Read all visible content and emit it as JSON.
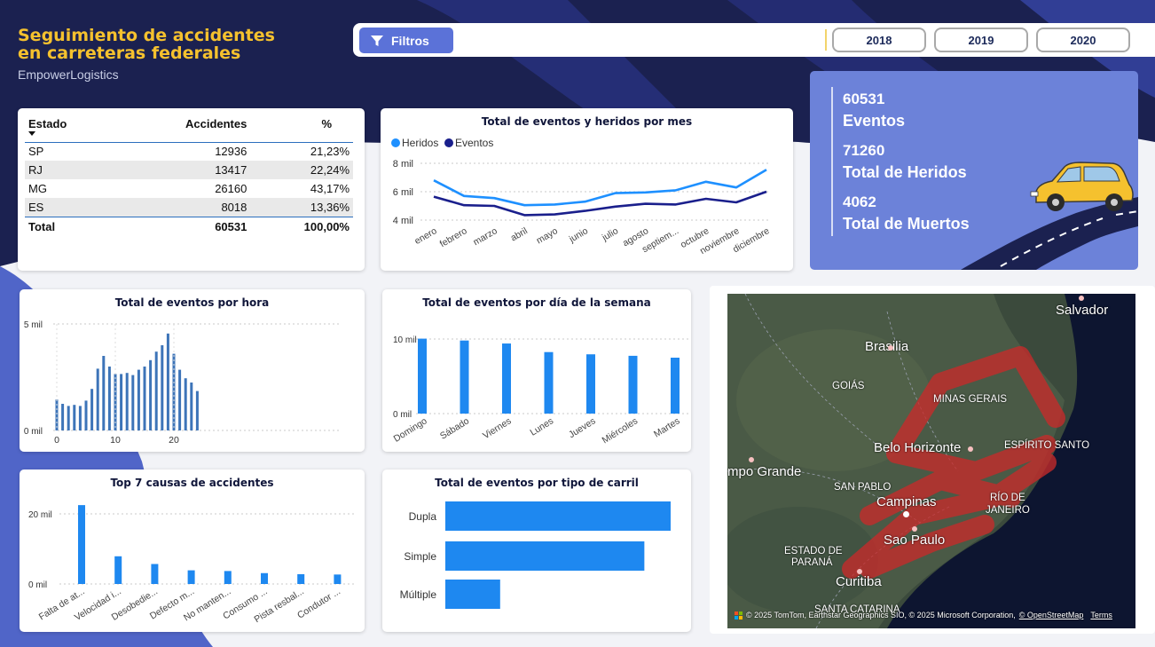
{
  "header": {
    "title_line1": "Seguimiento de accidentes",
    "title_line2": "en carreteras federales",
    "subtitle": "EmpowerLogistics"
  },
  "filters": {
    "button_label": "Filtros",
    "years": [
      "2018",
      "2019",
      "2020"
    ]
  },
  "state_table": {
    "columns": [
      "Estado",
      "Accidentes",
      "%"
    ],
    "rows": [
      {
        "estado": "SP",
        "accidentes": "12936",
        "pct": "21,23%"
      },
      {
        "estado": "RJ",
        "accidentes": "13417",
        "pct": "22,24%"
      },
      {
        "estado": "MG",
        "accidentes": "26160",
        "pct": "43,17%"
      },
      {
        "estado": "ES",
        "accidentes": "8018",
        "pct": "13,36%"
      }
    ],
    "total": {
      "estado": "Total",
      "accidentes": "60531",
      "pct": "100,00%"
    }
  },
  "kpis": [
    {
      "value": "60531",
      "label": "Eventos"
    },
    {
      "value": "71260",
      "label": "Total de Heridos"
    },
    {
      "value": "4062",
      "label": "Total de Muertos"
    }
  ],
  "colors": {
    "navy": "#1b2150",
    "accent": "#f5c12e",
    "blue_bar": "#1e88f0",
    "steel_bar": "#3d74b8",
    "kpi_bg": "#6c82d9",
    "heridos": "#1e90ff",
    "eventos": "#1a1f8c"
  },
  "map": {
    "icon": "map-icon",
    "attribution": "© 2025 TomTom, Earthstar Geographics SIO, © 2025 Microsoft Corporation,",
    "attribution_link": "© OpenStreetMap",
    "terms": "Terms",
    "labels": {
      "salvador": "Salvador",
      "brasilia": "Brasilia",
      "goias": "GOIÁS",
      "minas": "MINAS GERAIS",
      "bh": "Belo Horizonte",
      "es": "ESPÍRITO SANTO",
      "campo": "mpo Grande",
      "sanpablo": "SAN PABLO",
      "campinas": "Campinas",
      "rio1": "RÍO DE",
      "rio2": "JANEIRO",
      "sp": "Sao Paulo",
      "parana1": "ESTADO DE",
      "parana2": "PARANÁ",
      "curitiba": "Curitiba",
      "sc": "SANTA CATARINA"
    }
  },
  "chart_data": [
    {
      "type": "line",
      "title": "Total de eventos y heridos por mes",
      "categories": [
        "enero",
        "febrero",
        "marzo",
        "abril",
        "mayo",
        "junio",
        "julio",
        "agosto",
        "septiem...",
        "octubre",
        "noviembre",
        "diciembre"
      ],
      "series": [
        {
          "name": "Heridos",
          "values": [
            6800,
            5700,
            5550,
            5050,
            5100,
            5300,
            5900,
            5950,
            6100,
            6700,
            6300,
            7550
          ]
        },
        {
          "name": "Eventos",
          "values": [
            5650,
            5050,
            5000,
            4350,
            4400,
            4650,
            4950,
            5150,
            5100,
            5500,
            5250,
            6000
          ]
        }
      ],
      "yticks": [
        "4 mil",
        "6 mil",
        "8 mil"
      ],
      "ylim": [
        4000,
        8000
      ],
      "legend": "top-left"
    },
    {
      "type": "bar",
      "title": "Total de eventos por hora",
      "x": [
        0,
        1,
        2,
        3,
        4,
        5,
        6,
        7,
        8,
        9,
        10,
        11,
        12,
        13,
        14,
        15,
        16,
        17,
        18,
        19,
        20,
        21,
        22,
        23
      ],
      "values": [
        1450,
        1250,
        1150,
        1200,
        1150,
        1400,
        1950,
        2900,
        3500,
        3000,
        2650,
        2650,
        2700,
        2600,
        2850,
        3000,
        3300,
        3700,
        4000,
        4550,
        3600,
        2850,
        2450,
        2250,
        1850
      ],
      "xticks": [
        "0",
        "10",
        "20"
      ],
      "yticks": [
        "0 mil",
        "5 mil"
      ],
      "ylim": [
        0,
        5000
      ]
    },
    {
      "type": "bar",
      "title": "Total de eventos por día de la semana",
      "categories": [
        "Domingo",
        "Sábado",
        "Viernes",
        "Lunes",
        "Jueves",
        "Miércoles",
        "Martes"
      ],
      "values": [
        10050,
        9800,
        9400,
        8250,
        7950,
        7750,
        7500
      ],
      "yticks": [
        "0 mil",
        "10 mil"
      ],
      "ylim": [
        0,
        10000
      ]
    },
    {
      "type": "bar",
      "title": "Top 7 causas de accidentes",
      "categories": [
        "Falta de at...",
        "Velocidad i...",
        "Desobedie...",
        "Defecto m...",
        "No manten...",
        "Consumo ...",
        "Pista resbal...",
        "Condutor ..."
      ],
      "values": [
        22500,
        7900,
        5700,
        3900,
        3700,
        3100,
        2800,
        2700
      ],
      "yticks": [
        "0 mil",
        "20 mil"
      ],
      "ylim": [
        0,
        20000
      ]
    },
    {
      "type": "bar",
      "orientation": "horizontal",
      "title": "Total de eventos por tipo de carril",
      "categories": [
        "Dupla",
        "Simple",
        "Múltiple"
      ],
      "values": [
        30000,
        26500,
        7300
      ]
    }
  ]
}
